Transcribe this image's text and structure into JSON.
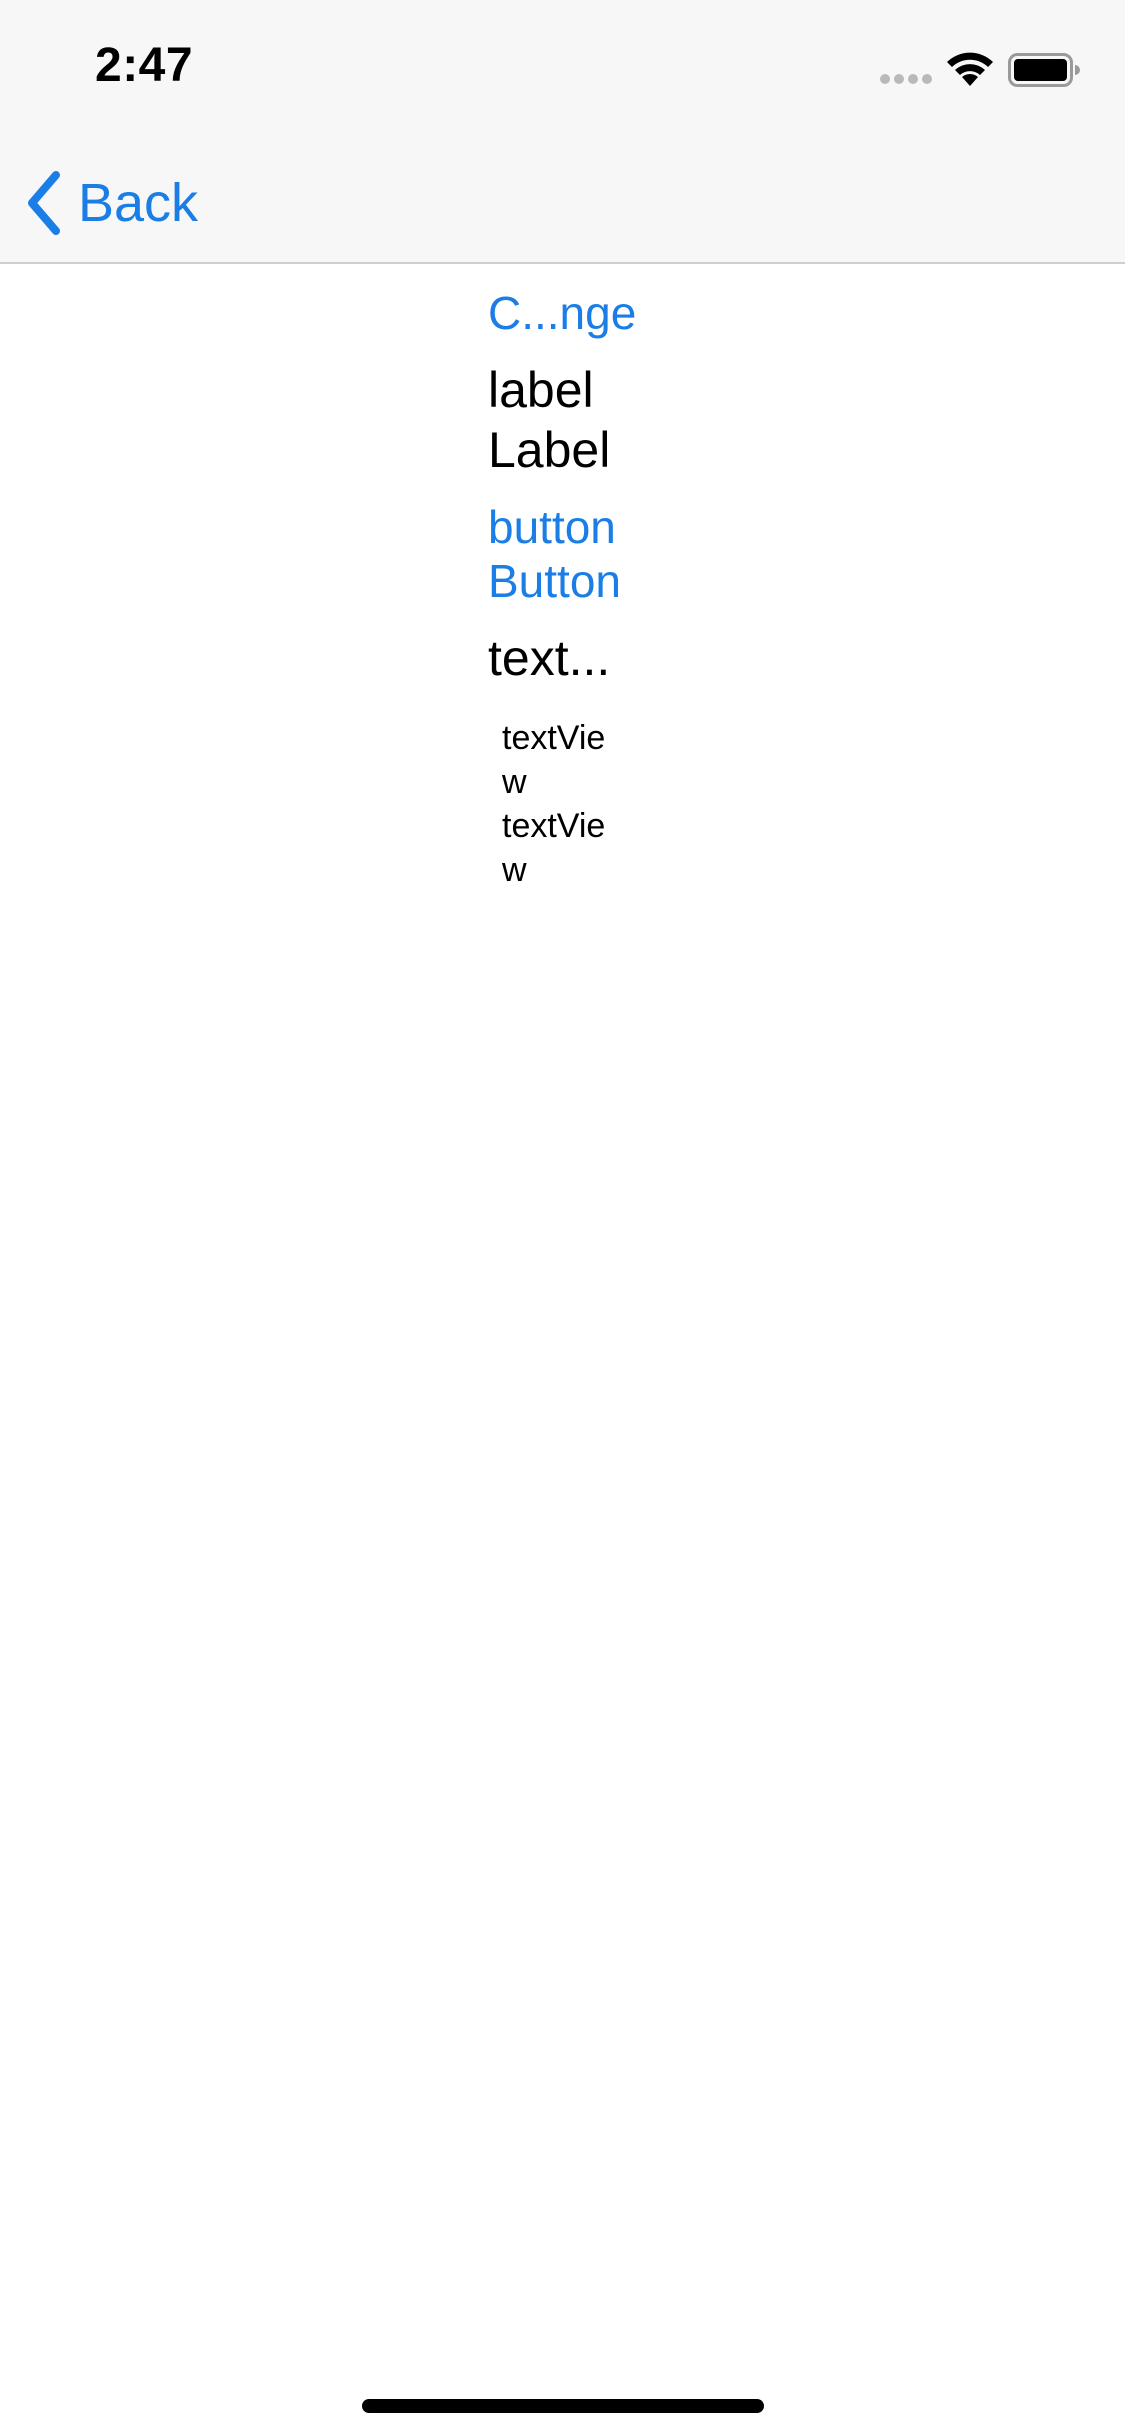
{
  "status_bar": {
    "time": "2:47",
    "icons": [
      "cellular-signal-icon",
      "wifi-icon",
      "battery-icon"
    ]
  },
  "nav_bar": {
    "back_label": "Back",
    "back_icon": "chevron-left-icon"
  },
  "content": {
    "segmented_label": "C...nge",
    "labels": [
      "label",
      "Label"
    ],
    "buttons": [
      "button",
      "Button"
    ],
    "text_field_value": "text...",
    "text_views": [
      "textVie",
      "w",
      "textVie",
      "w"
    ]
  },
  "colors": {
    "accent": "#1a7ee6",
    "bar_background": "#f7f7f7",
    "text": "#000000"
  }
}
